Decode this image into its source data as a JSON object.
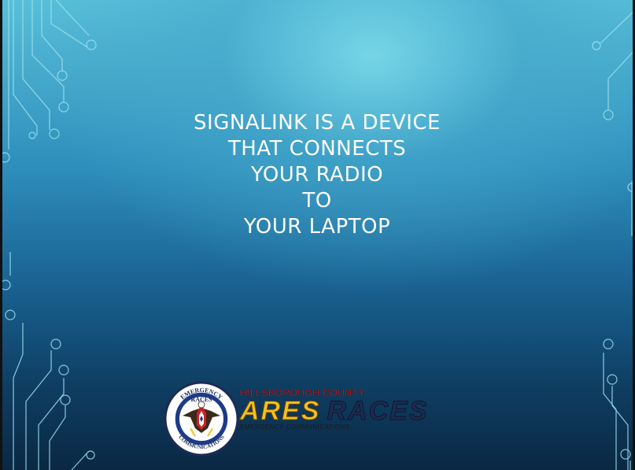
{
  "slide": {
    "title_lines": [
      "SIGNALINK IS A DEVICE",
      "THAT CONNECTS",
      "YOUR RADIO",
      "TO",
      "YOUR LAPTOP"
    ]
  },
  "logo": {
    "county": "HILLSBOROUGH COUNTY",
    "ares": "ARES",
    "races": "RACES",
    "subtitle": "EMERGENCY COMMUNICATIONS",
    "seal_top": "EMERGENCY",
    "seal_bottom": "COMMUNICATIONS",
    "seal_center": "RACES"
  },
  "colors": {
    "circuit": "#9fe3f0",
    "title": "#ffffff",
    "ares": "#f3c21b",
    "races": "#1d2b52",
    "county": "#dd2222"
  }
}
